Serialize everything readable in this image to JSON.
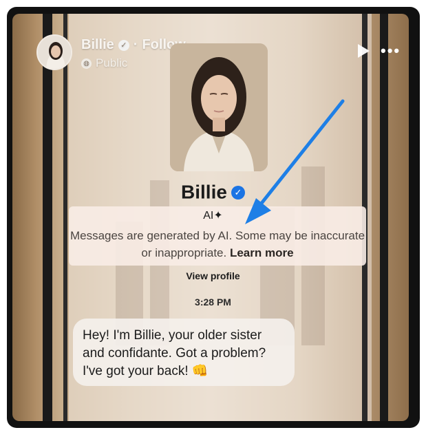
{
  "header": {
    "author_name": "Billie",
    "separator": "·",
    "follow_label": "Follow",
    "privacy_label": "Public"
  },
  "icons": {
    "header_verified": "verified-badge-icon",
    "privacy": "globe-icon",
    "play": "play-icon",
    "more": "more-options-icon",
    "ai_sparkle": "sparkle-icon",
    "emoji": "fist-bump-emoji"
  },
  "profile": {
    "name": "Billie",
    "ai_label": "AI",
    "ai_sparkle": "✦",
    "disclaimer_text": "Messages are generated by AI. Some may be inaccurate or inappropriate.",
    "learn_more_label": "Learn more",
    "view_profile_label": "View profile"
  },
  "chat": {
    "timestamp": "3:28 PM",
    "message": "Hey! I'm Billie, your older sister and confidante. Got a problem? I've got your back!",
    "emoji": "👊"
  },
  "colors": {
    "verified_blue": "#1b74e4",
    "arrow_blue": "#1e7fe6",
    "highlight_bg": "#f8ece6"
  }
}
